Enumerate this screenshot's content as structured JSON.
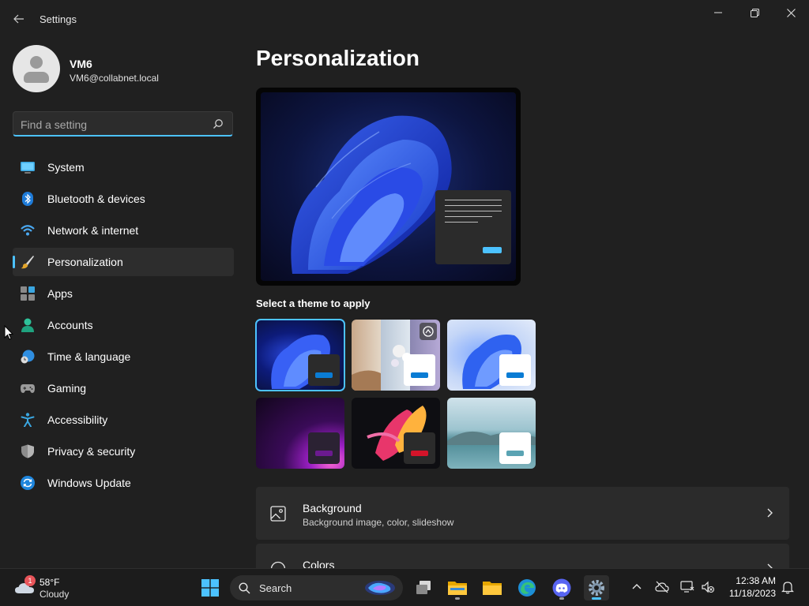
{
  "app": {
    "title": "Settings"
  },
  "user": {
    "name": "VM6",
    "email": "VM6@collabnet.local"
  },
  "search": {
    "placeholder": "Find a setting"
  },
  "nav": [
    {
      "label": "System",
      "icon": "monitor-icon",
      "active": false
    },
    {
      "label": "Bluetooth & devices",
      "icon": "bluetooth-icon",
      "active": false
    },
    {
      "label": "Network & internet",
      "icon": "wifi-icon",
      "active": false
    },
    {
      "label": "Personalization",
      "icon": "brush-icon",
      "active": true
    },
    {
      "label": "Apps",
      "icon": "apps-icon",
      "active": false
    },
    {
      "label": "Accounts",
      "icon": "person-icon",
      "active": false
    },
    {
      "label": "Time & language",
      "icon": "globe-clock-icon",
      "active": false
    },
    {
      "label": "Gaming",
      "icon": "gamepad-icon",
      "active": false
    },
    {
      "label": "Accessibility",
      "icon": "accessibility-icon",
      "active": false
    },
    {
      "label": "Privacy & security",
      "icon": "shield-icon",
      "active": false
    },
    {
      "label": "Windows Update",
      "icon": "sync-icon",
      "active": false
    }
  ],
  "main": {
    "title": "Personalization",
    "theme_heading": "Select a theme to apply",
    "themes": [
      {
        "name": "windows-dark",
        "selected": true,
        "accent": "#0a7cd4"
      },
      {
        "name": "windows-spotlight",
        "selected": false,
        "accent": "#0a7cd4"
      },
      {
        "name": "windows-light",
        "selected": false,
        "accent": "#0a7cd4"
      },
      {
        "name": "glow",
        "selected": false,
        "accent": "#6b1a8f"
      },
      {
        "name": "captured-motion",
        "selected": false,
        "accent": "#d4142a"
      },
      {
        "name": "flow",
        "selected": false,
        "accent": "#5aa3b3"
      }
    ],
    "cards": {
      "background": {
        "title": "Background",
        "subtitle": "Background image, color, slideshow"
      },
      "colors": {
        "title": "Colors"
      }
    }
  },
  "taskbar": {
    "weather": {
      "temp": "58°F",
      "condition": "Cloudy",
      "badge": "1"
    },
    "search_label": "Search",
    "clock": {
      "time": "12:38 AM",
      "date": "11/18/2023"
    }
  },
  "colors": {
    "accent": "#4cc2ff",
    "background": "#202020",
    "card": "#2b2b2b"
  }
}
